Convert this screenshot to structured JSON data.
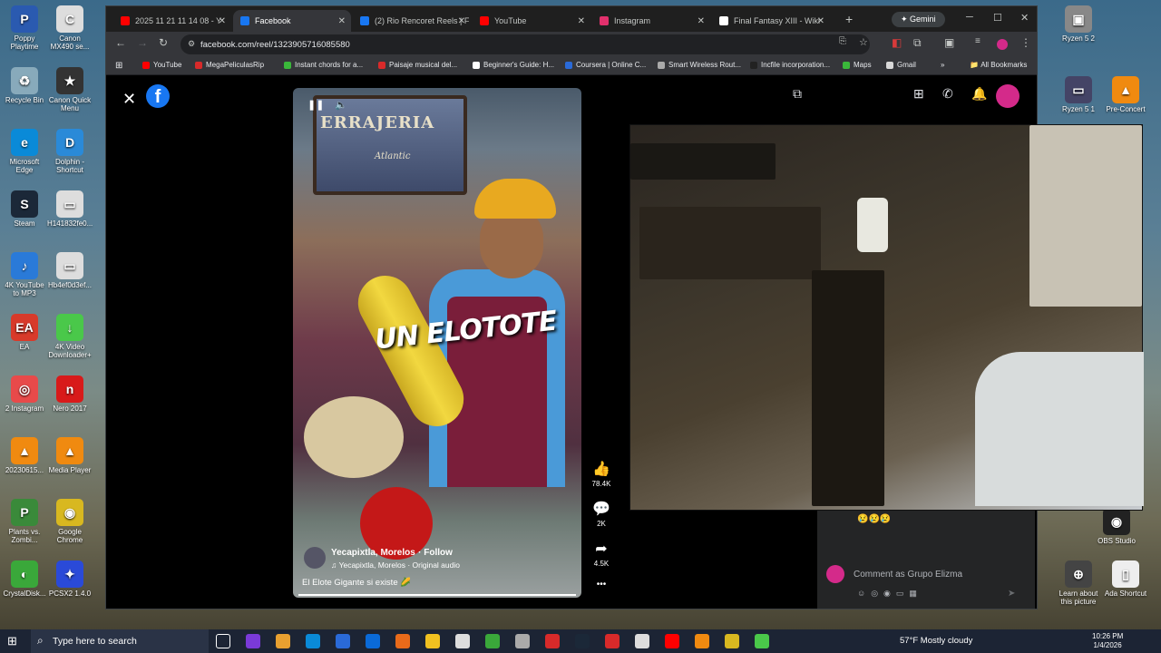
{
  "desktop": {
    "left_icons": [
      {
        "label": "Poppy Playtime",
        "color": "#2a5ab0",
        "glyph": "P"
      },
      {
        "label": "Canon MX490 se...",
        "color": "#ddd",
        "glyph": "C"
      },
      {
        "label": "Recycle Bin",
        "color": "#8ab",
        "glyph": "♻"
      },
      {
        "label": "Canon Quick Menu",
        "color": "#333",
        "glyph": "★"
      },
      {
        "label": "Microsoft Edge",
        "color": "#0a8ad8",
        "glyph": "e"
      },
      {
        "label": "Dolphin - Shortcut",
        "color": "#2a8ad8",
        "glyph": "D"
      },
      {
        "label": "Steam",
        "color": "#1b2838",
        "glyph": "S"
      },
      {
        "label": "H141832fe0...",
        "color": "#ddd",
        "glyph": "▭"
      },
      {
        "label": "4K YouTube to MP3",
        "color": "#2a7ad8",
        "glyph": "♪"
      },
      {
        "label": "Hb4ef0d3ef...",
        "color": "#ddd",
        "glyph": "▭"
      },
      {
        "label": "EA",
        "color": "#d83a2a",
        "glyph": "EA"
      },
      {
        "label": "4K Video Downloader+",
        "color": "#4ac84a",
        "glyph": "↓"
      },
      {
        "label": "2 Instagram",
        "color": "#e84a4a",
        "glyph": "◎"
      },
      {
        "label": "Nero 2017",
        "color": "#d81a1a",
        "glyph": "n"
      },
      {
        "label": "20230615...",
        "color": "#f08a10",
        "glyph": "▲"
      },
      {
        "label": "Media Player",
        "color": "#f08a10",
        "glyph": "▲"
      },
      {
        "label": "Plants vs. Zombi...",
        "color": "#3a8a3a",
        "glyph": "P"
      },
      {
        "label": "Google Chrome",
        "color": "#d8b820",
        "glyph": "◉"
      },
      {
        "label": "CrystalDisk...",
        "color": "#3aa83a",
        "glyph": "◐"
      },
      {
        "label": "PCSX2 1.4.0",
        "color": "#2a4ad8",
        "glyph": "✦"
      }
    ],
    "right_icons": [
      {
        "label": "Ryzen 5 2",
        "color": "#888",
        "glyph": "▣"
      },
      {
        "label": "Ryzen 5 1",
        "color": "#446",
        "glyph": "▭"
      },
      {
        "label": "Pre-Concert",
        "color": "#f08a10",
        "glyph": "▲"
      },
      {
        "label": "OBS Studio",
        "color": "#222",
        "glyph": "◉"
      },
      {
        "label": "Learn about this picture",
        "color": "#444",
        "glyph": "⊕"
      },
      {
        "label": "Ada Shortcut",
        "color": "#eee",
        "glyph": "▯"
      }
    ]
  },
  "browser": {
    "tabs": [
      {
        "label": "2025 11 21 11 14 08 - Y",
        "color": "#ff0000",
        "active": false
      },
      {
        "label": "Facebook",
        "color": "#1877f2",
        "active": true
      },
      {
        "label": "(2) Rio Rencoret Reels | F",
        "color": "#1877f2",
        "active": false
      },
      {
        "label": "YouTube",
        "color": "#ff0000",
        "active": false
      },
      {
        "label": "Instagram",
        "color": "#e1306c",
        "active": false
      },
      {
        "label": "Final Fantasy XIII - Wiki",
        "color": "#fff",
        "active": false
      }
    ],
    "gemini_label": "Gemini",
    "url": "facebook.com/reel/1323905716085580",
    "bookmarks": [
      {
        "label": "YouTube",
        "color": "#ff0000"
      },
      {
        "label": "MegaPeliculasRip",
        "color": "#d82a2a"
      },
      {
        "label": "Instant chords for a...",
        "color": "#3ab83a"
      },
      {
        "label": "Paisaje musical del...",
        "color": "#d82a2a"
      },
      {
        "label": "Beginner's Guide: H...",
        "color": "#fff"
      },
      {
        "label": "Coursera | Online C...",
        "color": "#2a6ad8"
      },
      {
        "label": "Smart Wireless Rout...",
        "color": "#aaa"
      },
      {
        "label": "Incfile incorporation...",
        "color": "#222"
      },
      {
        "label": "Maps",
        "color": "#3ab83a"
      },
      {
        "label": "Gmail",
        "color": "#d8d8d8"
      }
    ],
    "bookmarks_more": "»",
    "all_bookmarks": "All Bookmarks"
  },
  "reel": {
    "sign_text": "ERRAJERIA",
    "sign_sub": "Atlantic",
    "overlay_text": "UN ELOTOTE",
    "author": "Yecapixtla, Morelos",
    "follow": "· Follow",
    "audio": "♫ Yecapixtla, Morelos · Original audio",
    "caption": "El Elote Gigante si existe 🌽",
    "likes": "78.4K",
    "comments": "2K",
    "shares": "4.5K",
    "more": "•••"
  },
  "comments_panel": {
    "emojis": "😢😢😢",
    "placeholder": "Comment as Grupo Elizma"
  },
  "taskbar": {
    "search_placeholder": "Type here to search",
    "weather": "57°F  Mostly cloudy",
    "time": "10:26 PM",
    "date": "1/4/2026"
  }
}
